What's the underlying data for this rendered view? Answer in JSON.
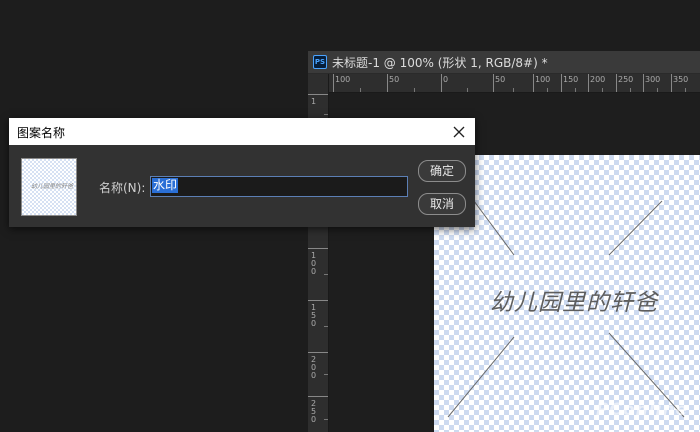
{
  "document": {
    "app_icon": "PS",
    "title": "未标题-1 @ 100% (形状 1, RGB/8#) *"
  },
  "ruler": {
    "h_labels": [
      "100",
      "50",
      "0",
      "50",
      "100",
      "150",
      "200",
      "250",
      "300",
      "350"
    ],
    "v_labels": [
      "1",
      "5",
      "0",
      "100",
      "150",
      "200",
      "250"
    ]
  },
  "canvas": {
    "text": "幼儿园里的轩爸",
    "watermark": "PConline"
  },
  "dialog": {
    "title": "图案名称",
    "preview_text": "幼儿园里的轩爸",
    "name_label": "名称(N):",
    "name_value": "水印",
    "ok_label": "确定",
    "cancel_label": "取消"
  },
  "colors": {
    "selection": "#2a6fd6",
    "checker": "#cddaf0",
    "ps_blue": "#4aa3ff"
  }
}
